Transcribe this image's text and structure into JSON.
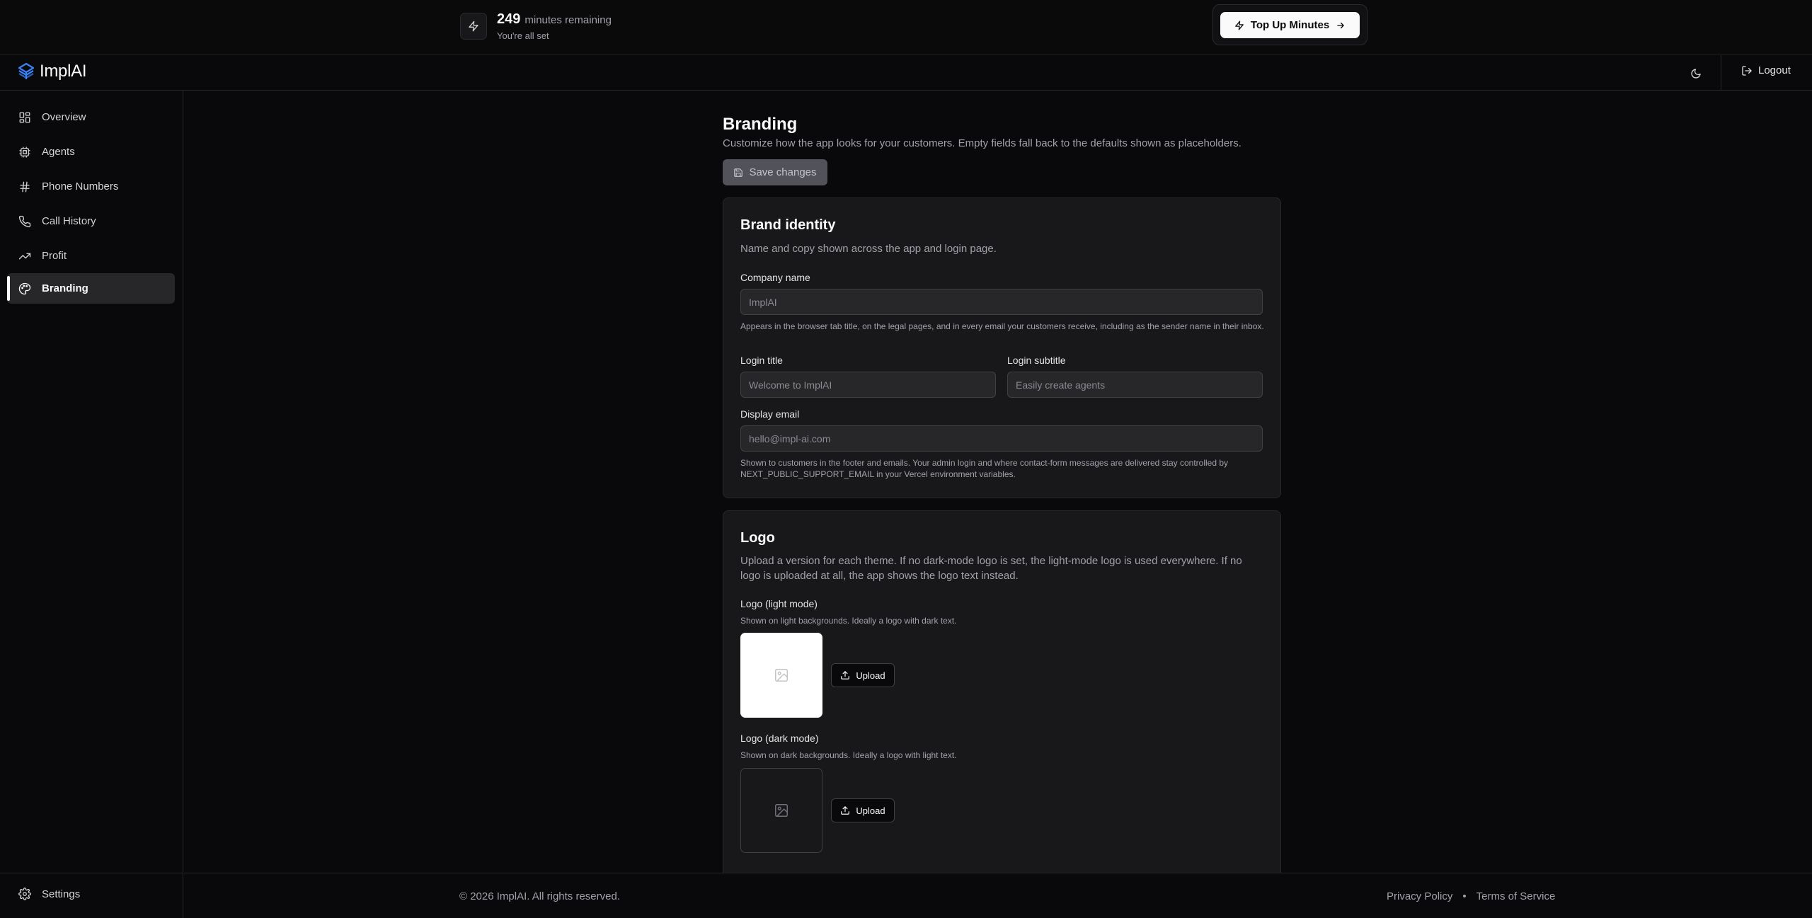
{
  "credits": {
    "minutes": "249",
    "unit_label": "minutes remaining",
    "status": "You're all set",
    "topup_label": "Top Up Minutes"
  },
  "header": {
    "app_name": "ImplAI",
    "logout_label": "Logout"
  },
  "sidebar": {
    "items": [
      {
        "label": "Overview",
        "icon": "dashboard-icon"
      },
      {
        "label": "Agents",
        "icon": "bot-icon"
      },
      {
        "label": "Phone Numbers",
        "icon": "hash-icon"
      },
      {
        "label": "Call History",
        "icon": "phone-icon"
      },
      {
        "label": "Profit",
        "icon": "trending-up-icon"
      },
      {
        "label": "Branding",
        "icon": "palette-icon",
        "active": true
      }
    ],
    "settings_label": "Settings"
  },
  "page": {
    "title": "Branding",
    "subtitle": "Customize how the app looks for your customers. Empty fields fall back to the defaults shown as placeholders.",
    "save_label": "Save changes"
  },
  "brand_identity": {
    "title": "Brand identity",
    "description": "Name and copy shown across the app and login page.",
    "company_name_label": "Company name",
    "company_name_placeholder": "ImplAI",
    "company_name_help": "Appears in the browser tab title, on the legal pages, and in every email your customers receive, including as the sender name in their inbox.",
    "login_title_label": "Login title",
    "login_title_placeholder": "Welcome to ImplAI",
    "login_subtitle_label": "Login subtitle",
    "login_subtitle_placeholder": "Easily create agents",
    "display_email_label": "Display email",
    "display_email_placeholder": "hello@impl-ai.com",
    "display_email_help": "Shown to customers in the footer and emails. Your admin login and where contact-form messages are delivered stay controlled by NEXT_PUBLIC_SUPPORT_EMAIL in your Vercel environment variables."
  },
  "logo": {
    "title": "Logo",
    "description": "Upload a version for each theme. If no dark-mode logo is set, the light-mode logo is used everywhere. If no logo is uploaded at all, the app shows the logo text instead.",
    "light_label": "Logo (light mode)",
    "light_help": "Shown on light backgrounds. Ideally a logo with dark text.",
    "dark_label": "Logo (dark mode)",
    "dark_help": "Shown on dark backgrounds. Ideally a logo with light text.",
    "upload_label": "Upload"
  },
  "footer": {
    "copyright": "© 2026 ImplAI. All rights reserved.",
    "privacy_label": "Privacy Policy",
    "separator": "•",
    "terms_label": "Terms of Service"
  },
  "colors": {
    "background": "#09090b",
    "card": "#18181b",
    "border": "#27272a",
    "brand_logo": "#3b82f6"
  }
}
